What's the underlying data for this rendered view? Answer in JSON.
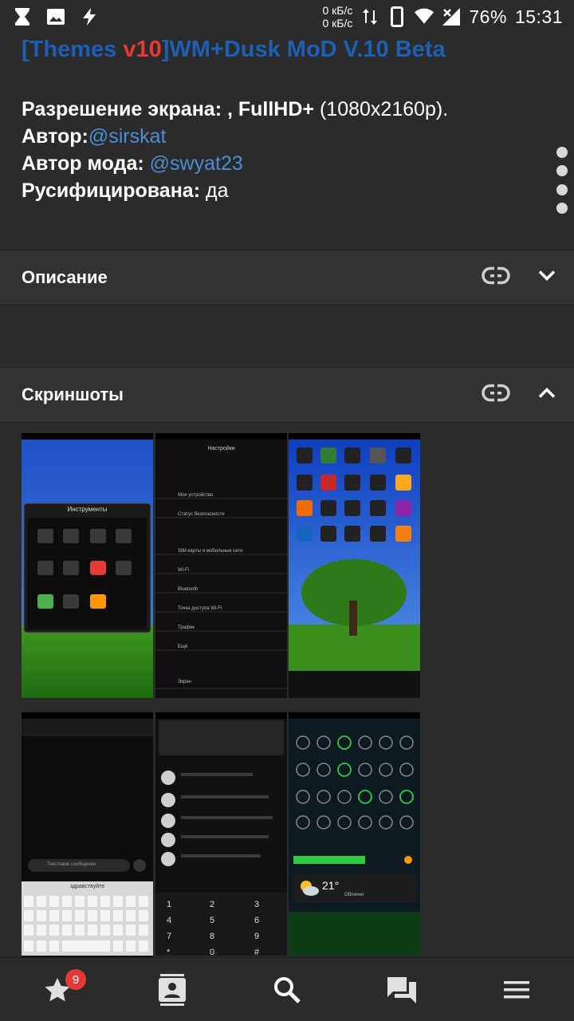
{
  "status_bar": {
    "net_up": "0 кБ/с",
    "net_down": "0 кБ/с",
    "battery": "76%",
    "time": "15:31"
  },
  "post": {
    "title_open": "[Themes ",
    "title_version": "v10",
    "title_rest": "]WM+Dusk MoD V.10 Beta",
    "resolution_label": "Разрешение экрана: , FullHD+",
    "resolution_value": " (1080x2160p).",
    "author_label": "Автор:",
    "author_value": "@sirskat",
    "mod_author_label": "Автор мода: ",
    "mod_author_value": "@swyat23",
    "russified_label": "Русифицирована:",
    "russified_value": " да"
  },
  "sections": {
    "description": "Описание",
    "screenshots": "Скриншоты"
  },
  "shots": {
    "tools_title": "Инструменты",
    "settings_title": "Настройки",
    "settings_items": [
      "Мое устройство",
      "Статус безопасности",
      "SIM-карты и мобильные сети",
      "Wi-Fi",
      "Bluetooth",
      "Точка доступа Wi-Fi",
      "Трафик",
      "Ещё",
      "Экран"
    ],
    "keyboard_suggestion": "здравствуйте",
    "sms_hint": "Текстовое сообщение",
    "weather_temp": "21°",
    "weather_desc": "Облачно"
  },
  "bottom_nav": {
    "badge_count": "9",
    "items": [
      "favorites-icon",
      "contacts-icon",
      "search-icon",
      "messages-icon",
      "menu-icon"
    ]
  },
  "colors": {
    "title_blue": "#1e5fb6",
    "version_red": "#e53935",
    "link_blue": "#4b8ed6",
    "badge_red": "#e53935"
  }
}
